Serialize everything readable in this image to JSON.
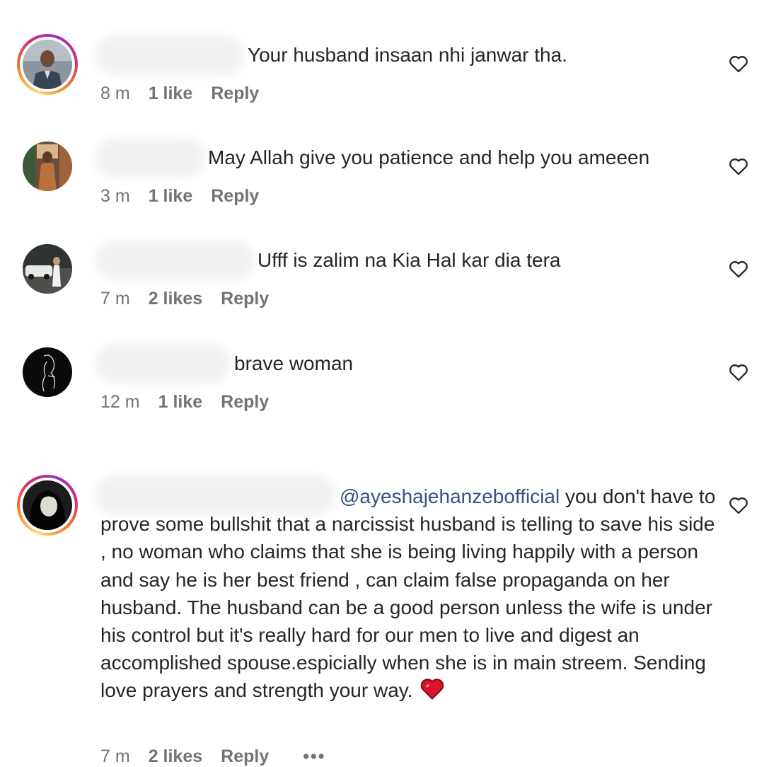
{
  "comments": [
    {
      "text": "Your husband insaan nhi janwar tha.",
      "time": "8 m",
      "likes": "1 like",
      "reply": "Reply"
    },
    {
      "text": "May Allah give you patience and help you ameeen",
      "time": "3 m",
      "likes": "1 like",
      "reply": "Reply"
    },
    {
      "text": "Ufff is zalim na Kia Hal kar dia tera",
      "time": "7 m",
      "likes": "2 likes",
      "reply": "Reply"
    },
    {
      "text": "brave woman",
      "time": "12 m",
      "likes": "1 like",
      "reply": "Reply"
    },
    {
      "mention": "@ayeshajehanzebofficial",
      "text": " you don't have to prove some bullshit that a narcissist husband is telling to save his side , no woman who claims that she is being living happily with a person and say he is her best friend , can claim false propaganda on her husband. The husband can be a good person unless the wife is under his control but it's really hard for our men to live and digest an accomplished spouse.espicially when she is in main streem. Sending love prayers and strength your way.",
      "time": "7 m",
      "likes": "2 likes",
      "reply": "Reply",
      "more": "•••"
    }
  ],
  "icons": {
    "like": "heart-outline-icon",
    "emoji": "red-heart-emoji",
    "more": "more-dots-icon"
  },
  "colors": {
    "mention": "#385185",
    "meta": "#737373",
    "text": "#262626",
    "heart_emoji": "#e0132d"
  }
}
